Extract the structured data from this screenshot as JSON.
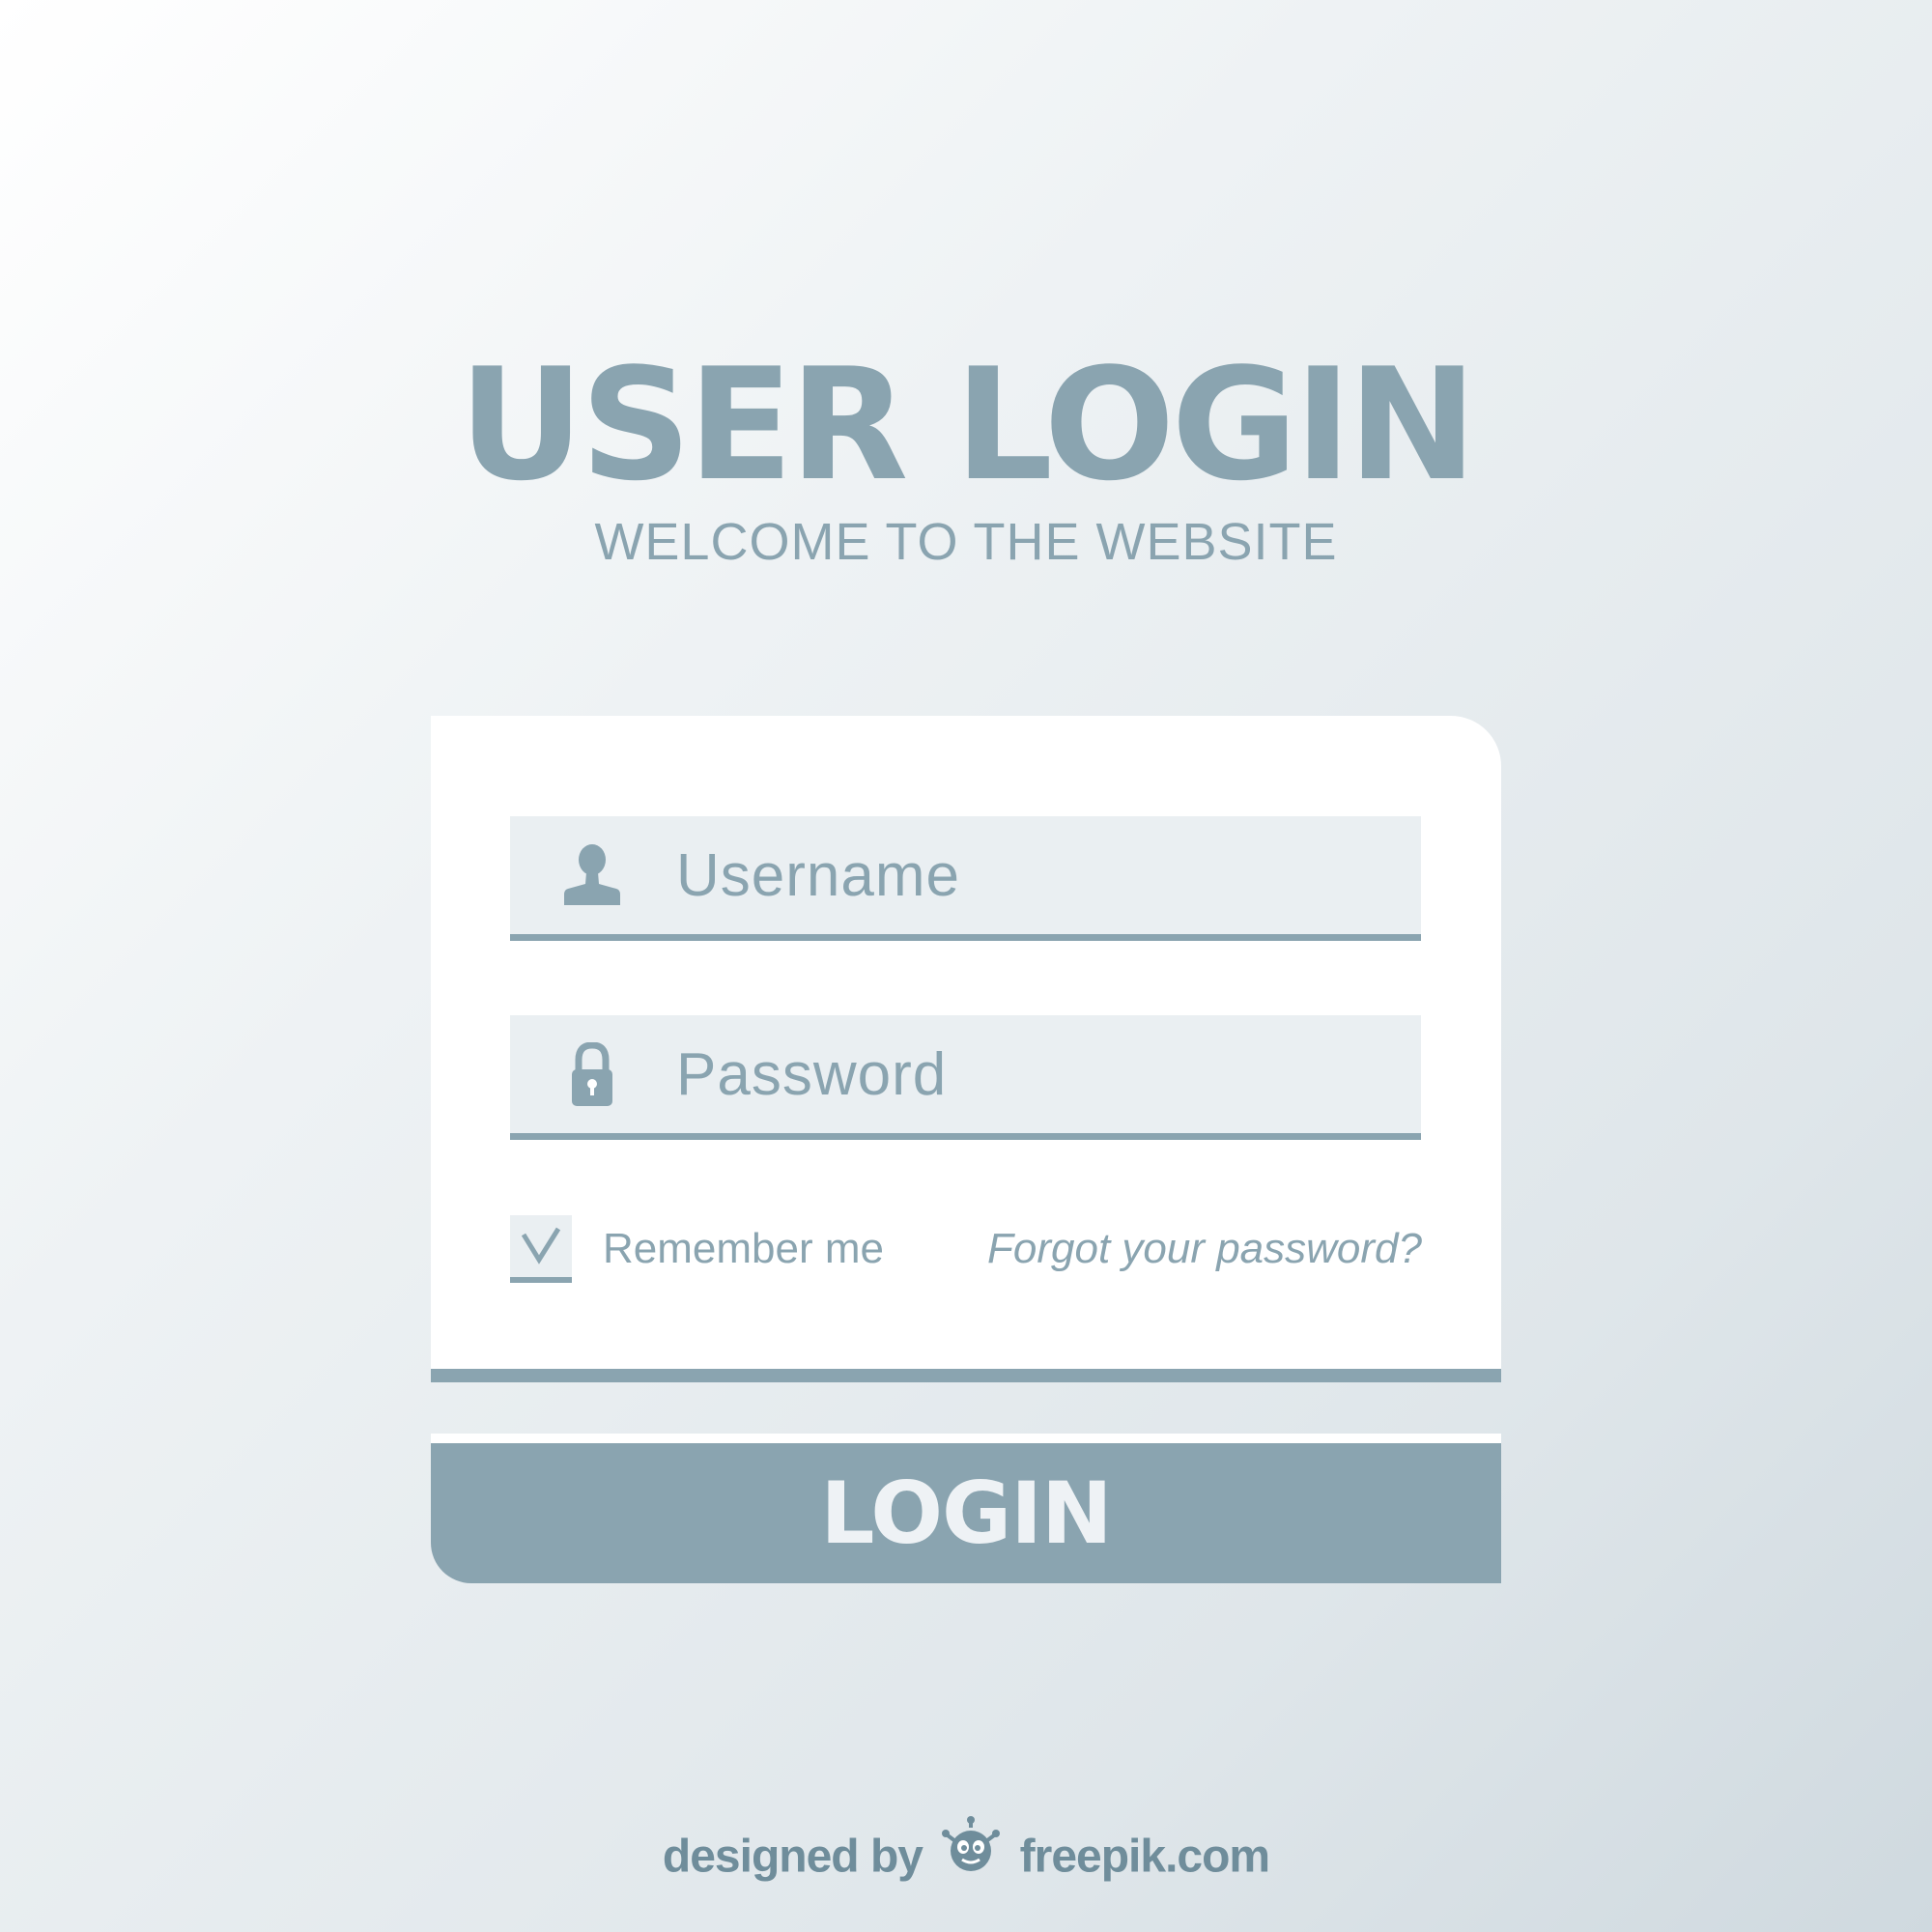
{
  "header": {
    "title": "USER LOGIN",
    "subtitle": "WELCOME TO THE WEBSITE"
  },
  "form": {
    "username": {
      "placeholder": "Username",
      "icon": "user-icon"
    },
    "password": {
      "placeholder": "Password",
      "icon": "lock-icon"
    },
    "remember_me": {
      "label": "Remember me",
      "checked": true
    },
    "forgot_password": "Forgot your password?",
    "login_label": "LOGIN"
  },
  "footer": {
    "prefix": "designed by",
    "brand": "freepik.com",
    "logo_icon": "freepik-logo-icon"
  },
  "colors": {
    "accent": "#8aa4b0",
    "field_background": "#eaeff2",
    "card_background": "#ffffff"
  }
}
